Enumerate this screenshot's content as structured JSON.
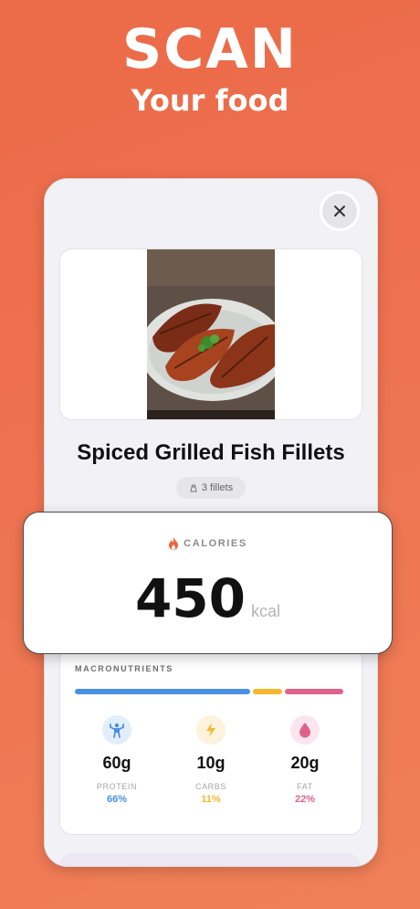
{
  "hero": {
    "title": "SCAN",
    "subtitle": "Your food"
  },
  "food": {
    "name": "Spiced Grilled Fish Fillets",
    "serving": "3 fillets"
  },
  "calories": {
    "label": "CALORIES",
    "value": "450",
    "unit": "kcal"
  },
  "macros": {
    "title": "MACRONUTRIENTS",
    "items": [
      {
        "value": "60g",
        "name": "PROTEIN",
        "percent": "66%",
        "share": 0.66,
        "color": "#4a90e2",
        "icon": "flexing-person-icon"
      },
      {
        "value": "10g",
        "name": "CARBS",
        "percent": "11%",
        "share": 0.11,
        "color": "#f5b731",
        "icon": "lightning-bolt-icon"
      },
      {
        "value": "20g",
        "name": "FAT",
        "percent": "22%",
        "share": 0.22,
        "color": "#e0628c",
        "icon": "drop-icon"
      }
    ]
  },
  "colors": {
    "accent": "#ef7050",
    "flame": "#f0633a"
  }
}
